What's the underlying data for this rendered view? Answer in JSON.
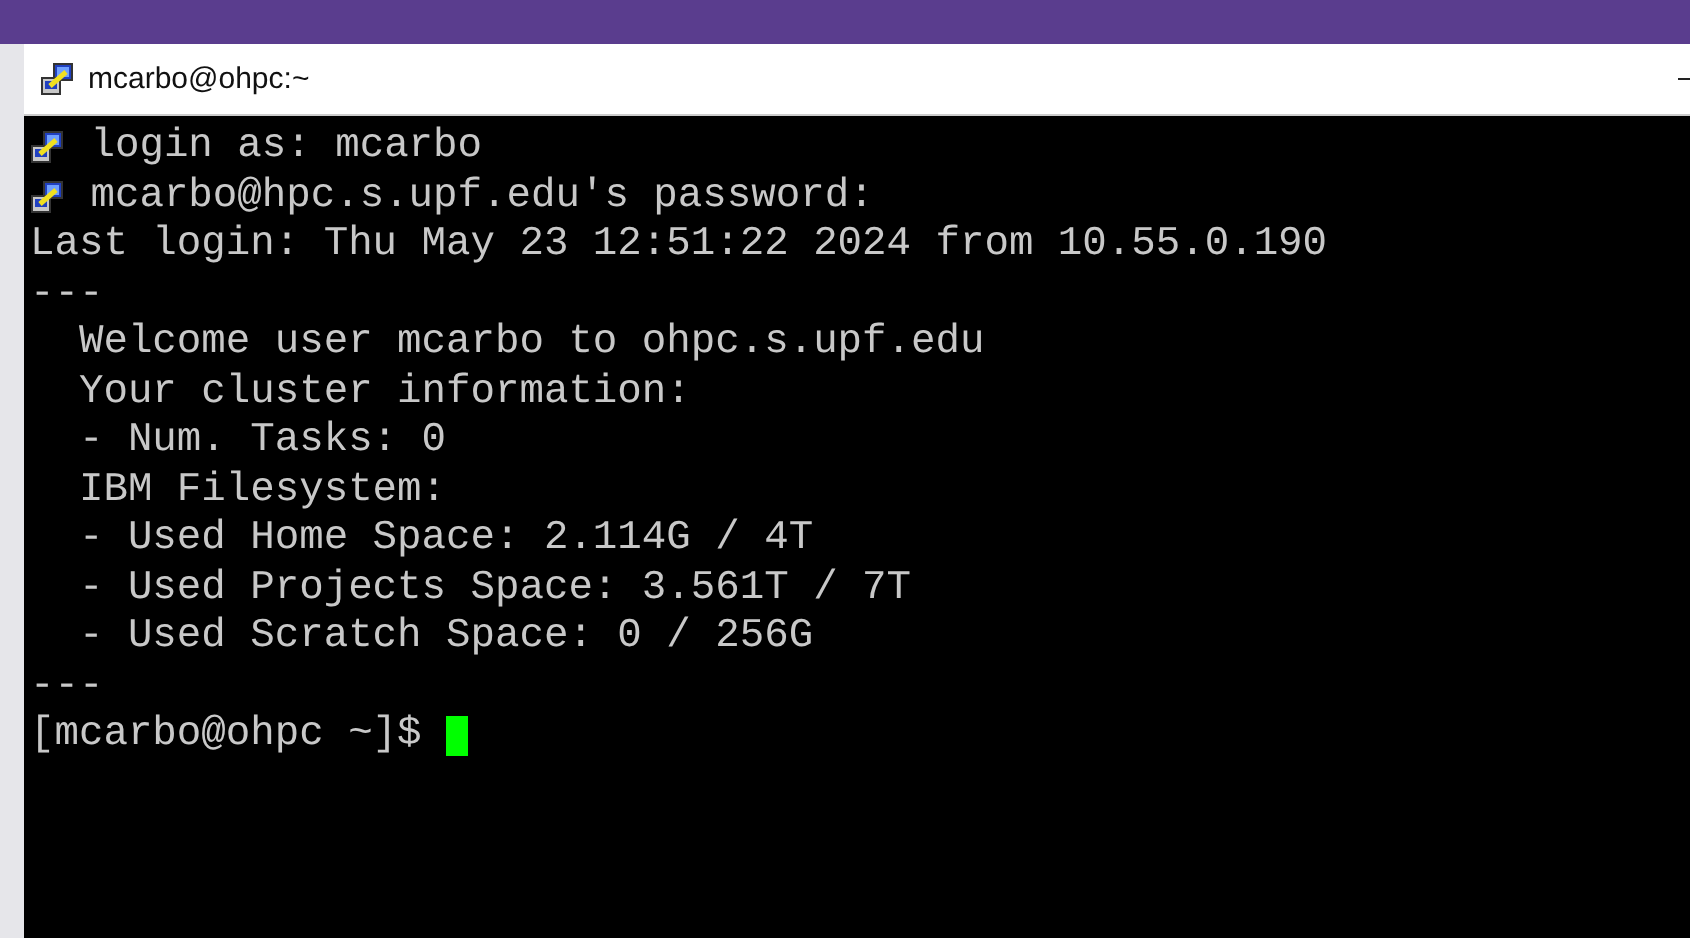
{
  "window": {
    "title": "mcarbo@ohpc:~"
  },
  "terminal": {
    "lines": [
      {
        "kind": "icon",
        "text": " login as: mcarbo"
      },
      {
        "kind": "icon",
        "text": " mcarbo@hpc.s.upf.edu's password:"
      },
      {
        "kind": "plain",
        "text": "Last login: Thu May 23 12:51:22 2024 from 10.55.0.190"
      },
      {
        "kind": "plain",
        "text": "---"
      },
      {
        "kind": "plain",
        "text": "  Welcome user mcarbo to ohpc.s.upf.edu"
      },
      {
        "kind": "plain",
        "text": "  Your cluster information:"
      },
      {
        "kind": "plain",
        "text": "  - Num. Tasks: 0"
      },
      {
        "kind": "plain",
        "text": "  IBM Filesystem:"
      },
      {
        "kind": "plain",
        "text": "  - Used Home Space: 2.114G / 4T"
      },
      {
        "kind": "plain",
        "text": "  - Used Projects Space: 3.561T / 7T"
      },
      {
        "kind": "plain",
        "text": "  - Used Scratch Space: 0 / 256G"
      },
      {
        "kind": "plain",
        "text": "---"
      },
      {
        "kind": "prompt",
        "text": "[mcarbo@ohpc ~]$ "
      }
    ]
  }
}
